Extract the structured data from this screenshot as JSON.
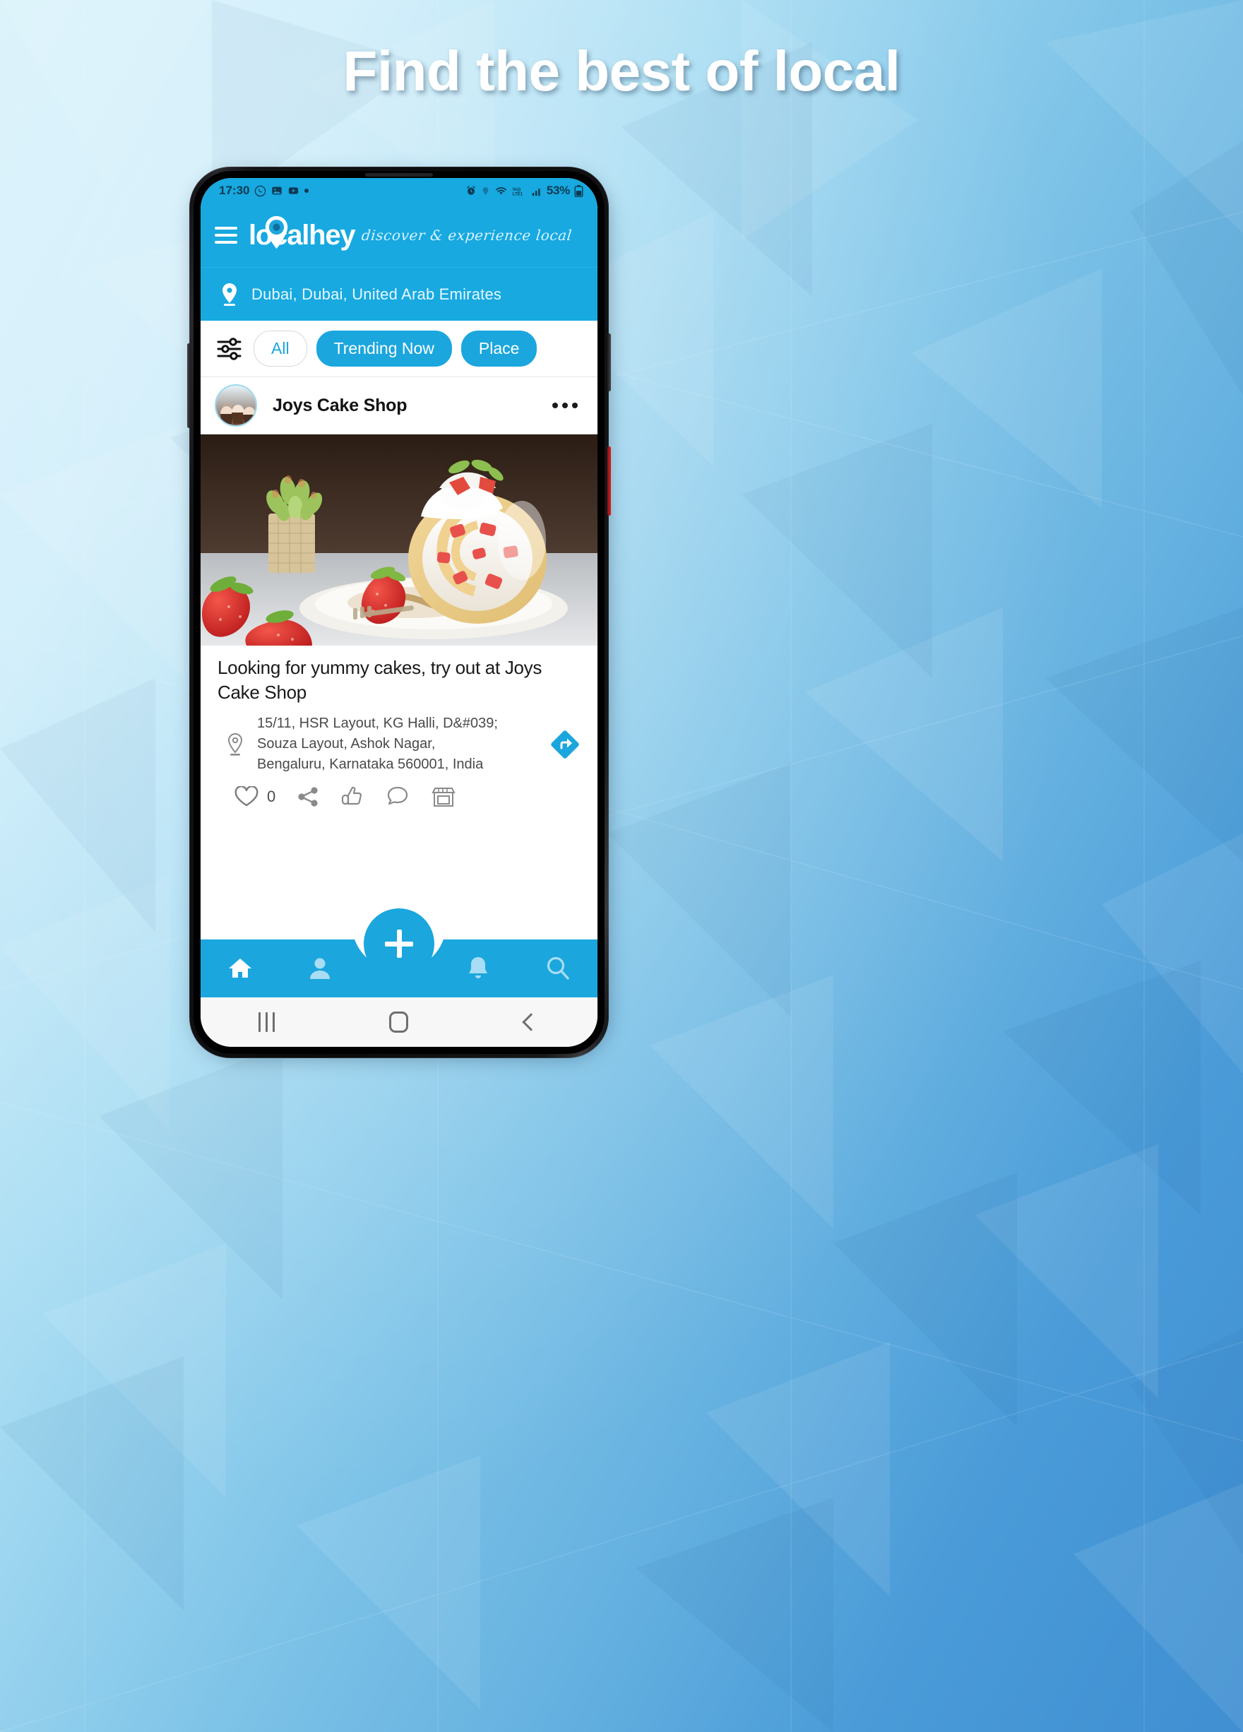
{
  "promo": {
    "headline": "Find the best of local",
    "accent": "#17a9e0",
    "bg_light": "#d9f2fb",
    "bg_dark": "#3f8fd2"
  },
  "phone": {
    "status_bar": {
      "time": "17:30",
      "left_icons": [
        "whatsapp-icon",
        "gallery-icon",
        "youtube-icon",
        "dot-icon"
      ],
      "right_icons": [
        "alarm-icon",
        "location-icon",
        "wifi-icon",
        "volte-icon",
        "signal-icon"
      ],
      "battery_percent": "53%",
      "battery_icon": "battery-icon"
    },
    "app_header": {
      "menu_icon": "hamburger-menu-icon",
      "logo_text": "localhey",
      "logo_pin_icon": "map-pin-icon",
      "tagline": "discover & experience local"
    },
    "location_bar": {
      "pin_icon": "location-pin-icon",
      "location": "Dubai, Dubai, United Arab Emirates"
    },
    "filters": {
      "filter_icon": "sliders-filter-icon",
      "chips": [
        {
          "label": "All",
          "selected": false,
          "style": "outline"
        },
        {
          "label": "Trending Now",
          "selected": true,
          "style": "filled"
        },
        {
          "label": "Place",
          "selected": true,
          "style": "filled"
        }
      ]
    },
    "post": {
      "avatar_name": "shop-avatar",
      "shop_name": "Joys Cake Shop",
      "more_icon": "more-options-icon",
      "image_alt": "strawberry-swiss-roll-cake-photo",
      "caption": "Looking for yummy cakes, try out at Joys Cake Shop",
      "address_icon": "address-pin-icon",
      "address_line1": "15/11, HSR Layout, KG Halli, D&#039;",
      "address_line2": "Souza Layout, Ashok Nagar,",
      "address_line3": "Bengaluru, Karnataka 560001, India",
      "directions_icon": "directions-arrow-icon",
      "actions": [
        {
          "name": "like-heart-icon",
          "label": ""
        },
        {
          "name": "like-count",
          "label": "0"
        },
        {
          "name": "share-icon",
          "label": ""
        },
        {
          "name": "thumbs-up-icon",
          "label": ""
        },
        {
          "name": "comment-icon",
          "label": ""
        },
        {
          "name": "store-icon",
          "label": ""
        }
      ]
    },
    "bottom_nav": {
      "fab_icon": "add-plus-icon",
      "items": [
        {
          "name": "nav-home",
          "icon": "home-icon",
          "active": true
        },
        {
          "name": "nav-profile",
          "icon": "person-icon",
          "active": false
        },
        {
          "name": "nav-notifications",
          "icon": "bell-icon",
          "active": false
        },
        {
          "name": "nav-search",
          "icon": "search-icon",
          "active": false
        }
      ]
    },
    "android_nav": {
      "recents_icon": "recents-icon",
      "home_icon": "home-key-icon",
      "back_icon": "back-key-icon"
    }
  }
}
